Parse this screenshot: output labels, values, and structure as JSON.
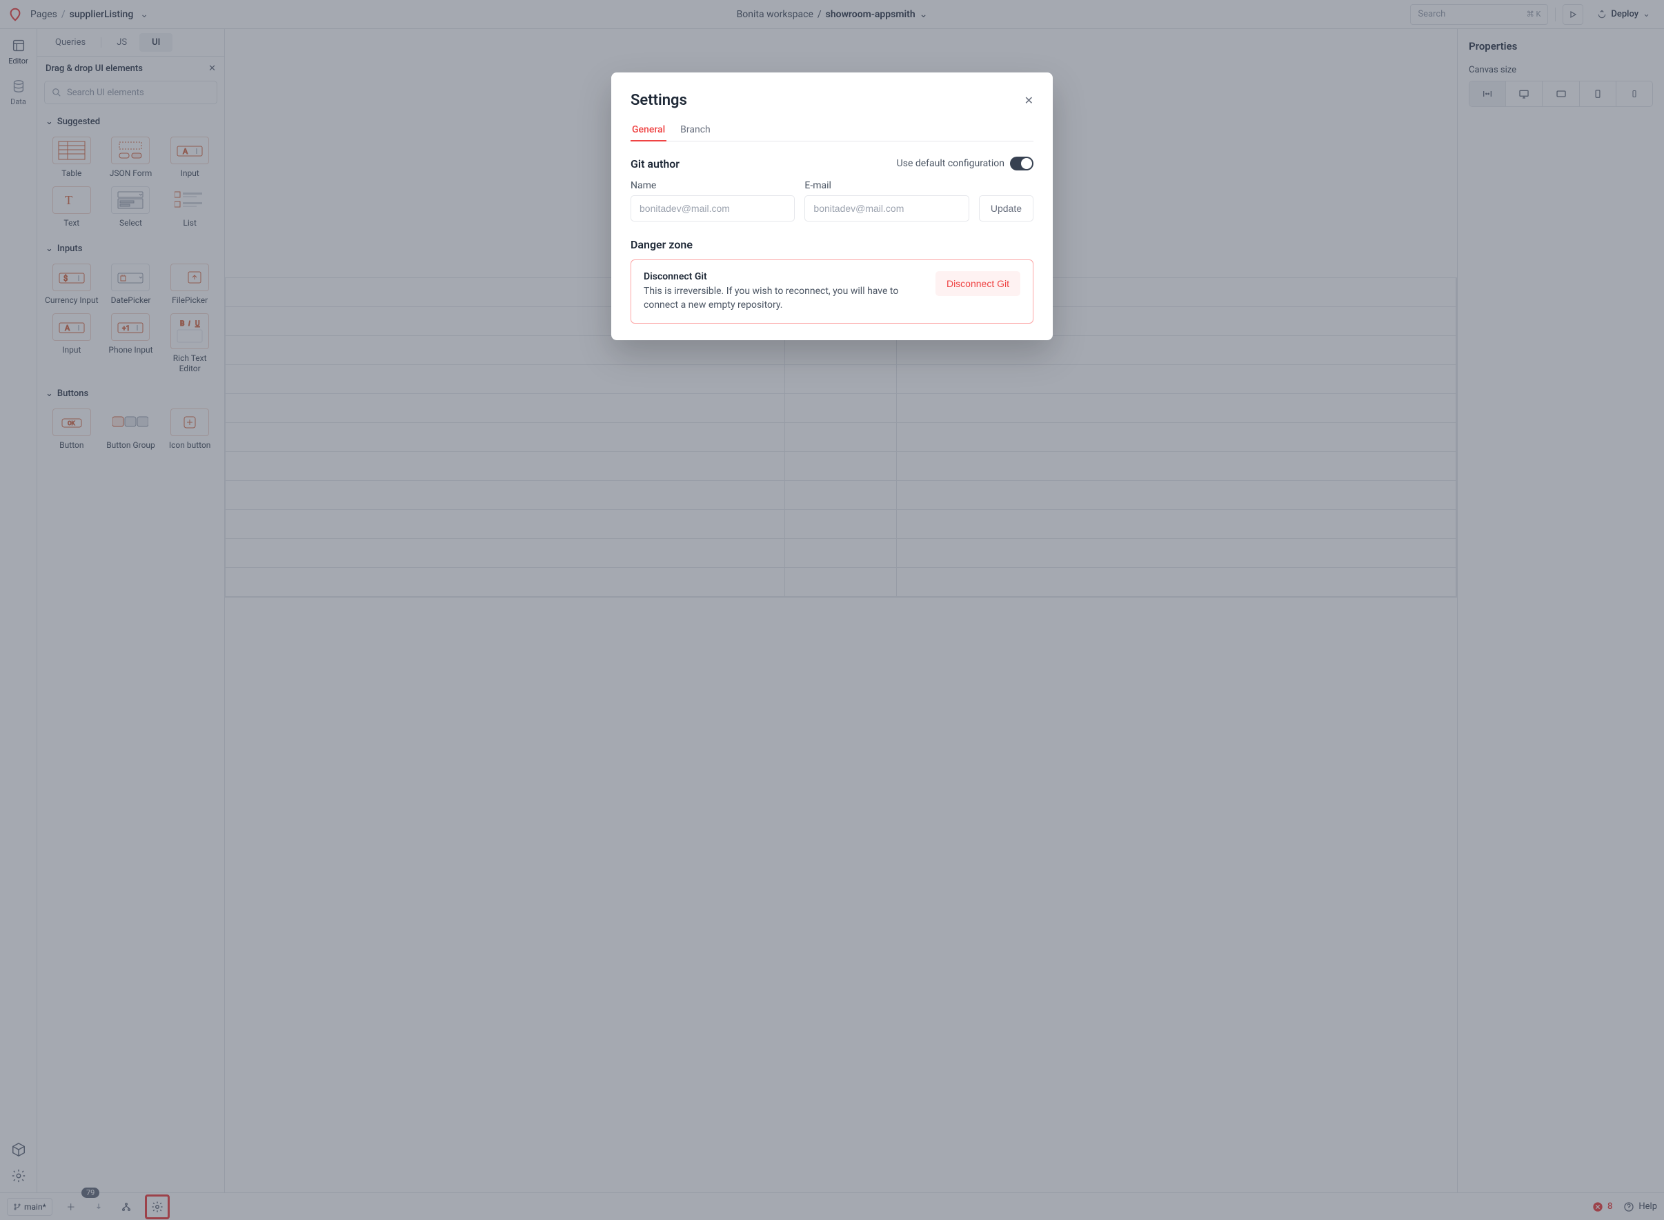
{
  "topbar": {
    "pages_label": "Pages",
    "page_name": "supplierListing",
    "workspace": "Bonita workspace",
    "app_name": "showroom-appsmith",
    "search_placeholder": "Search",
    "search_kbd": "⌘ K",
    "deploy_label": "Deploy"
  },
  "rail": {
    "editor": "Editor",
    "data": "Data"
  },
  "left": {
    "tabs": {
      "queries": "Queries",
      "js": "JS",
      "ui": "UI"
    },
    "drag_title": "Drag & drop UI elements",
    "search_placeholder": "Search UI elements",
    "sections": {
      "suggested": "Suggested",
      "inputs": "Inputs",
      "buttons": "Buttons"
    },
    "widgets": {
      "table": "Table",
      "json_form": "JSON Form",
      "input": "Input",
      "text": "Text",
      "select": "Select",
      "list": "List",
      "currency": "Currency Input",
      "datepicker": "DatePicker",
      "filepicker": "FilePicker",
      "input2": "Input",
      "phone": "Phone Input",
      "rte": "Rich Text Editor",
      "button": "Button",
      "button_group": "Button Group",
      "icon_button": "Icon button"
    }
  },
  "right": {
    "title": "Properties",
    "canvas_size": "Canvas size"
  },
  "bottom": {
    "branch": "main*",
    "count": "79",
    "errors": "8",
    "help": "Help"
  },
  "modal": {
    "title": "Settings",
    "tabs": {
      "general": "General",
      "branch": "Branch"
    },
    "git_author": "Git author",
    "use_default": "Use default configuration",
    "name_label": "Name",
    "email_label": "E-mail",
    "name_placeholder": "bonitadev@mail.com",
    "email_placeholder": "bonitadev@mail.com",
    "update": "Update",
    "danger_zone": "Danger zone",
    "disconnect_title": "Disconnect Git",
    "disconnect_desc": "This is irreversible. If you wish to reconnect, you will have to connect a new empty repository.",
    "disconnect_btn": "Disconnect Git"
  }
}
